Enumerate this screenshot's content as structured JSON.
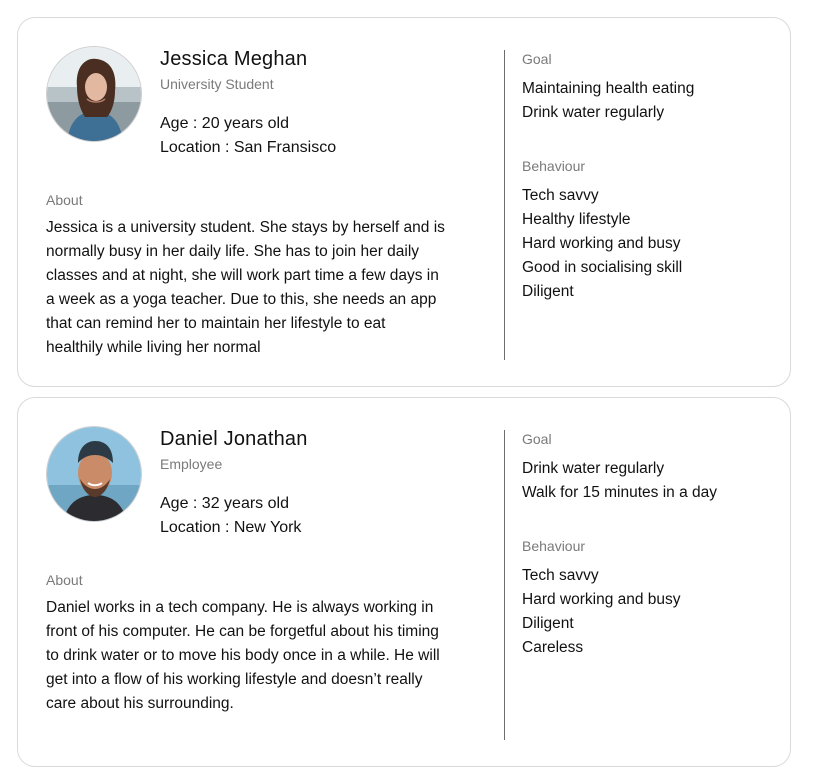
{
  "personas": [
    {
      "name": "Jessica Meghan",
      "role": "University Student",
      "age": "Age : 20 years old",
      "location": "Location : San Fransisco",
      "about_label": "About",
      "about": "Jessica is a university student. She stays by herself and is normally busy in her daily life. She has to join her daily classes and at night, she will work part time a few days in a week as a yoga teacher. Due to this, she needs an app that can remind her to maintain her lifestyle to eat healthily while living her normal",
      "goal_label": "Goal",
      "goals": [
        "Maintaining health eating",
        "Drink water regularly"
      ],
      "behaviour_label": "Behaviour",
      "behaviours": [
        "Tech savvy",
        "Healthy lifestyle",
        "Hard working and busy",
        "Good in socialising skill",
        "Diligent"
      ]
    },
    {
      "name": "Daniel Jonathan",
      "role": "Employee",
      "age": "Age : 32 years old",
      "location": "Location : New York",
      "about_label": "About",
      "about": "Daniel works in a tech company. He is always working in front of his computer. He can be forgetful about his timing to drink water or to move his body once in a while. He will get into a flow of his working lifestyle and doesn’t really care about his surrounding.",
      "goal_label": "Goal",
      "goals": [
        "Drink water regularly",
        "Walk for 15 minutes in a day"
      ],
      "behaviour_label": "Behaviour",
      "behaviours": [
        "Tech savvy",
        "Hard working and busy",
        "Diligent",
        "Careless"
      ]
    }
  ]
}
